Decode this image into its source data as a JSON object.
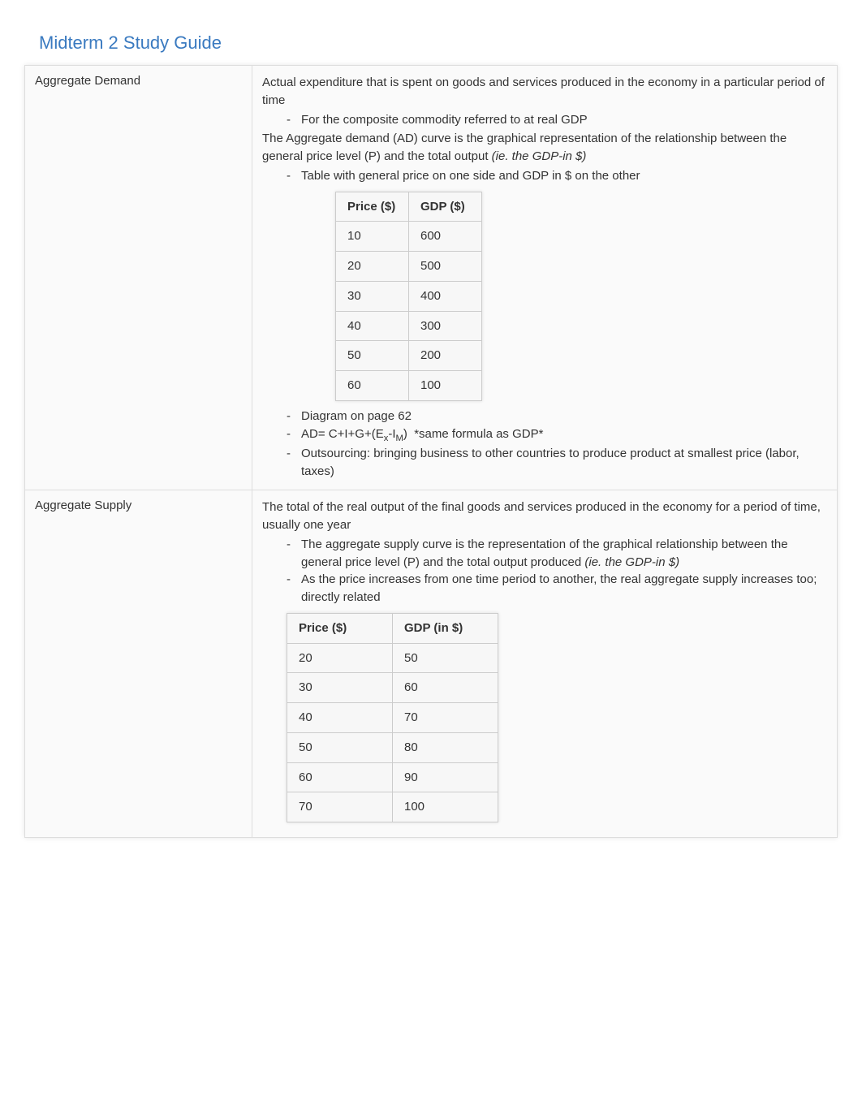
{
  "title": "Midterm 2 Study Guide",
  "rows": [
    {
      "term": "Aggregate Demand",
      "intro1": "Actual expenditure that is spent on goods and services produced in the economy in a particular period of time",
      "bullets1": [
        "For the composite commodity referred to at real GDP"
      ],
      "intro2a": "The Aggregate demand (AD) curve is the graphical representation of the relationship between the general price level (P) and the total output ",
      "intro2b": "(ie. the GDP-in $)",
      "bullets2": [
        "Table with general price on one side and GDP in $ on the other"
      ],
      "table": {
        "head": [
          "Price ($)",
          "GDP ($)"
        ],
        "body": [
          [
            "10",
            "600"
          ],
          [
            "20",
            "500"
          ],
          [
            "30",
            "400"
          ],
          [
            "40",
            "300"
          ],
          [
            "50",
            "200"
          ],
          [
            "60",
            "100"
          ]
        ]
      },
      "bullets3": [
        "Diagram on page 62",
        "AD= C+I+G+(Ex-IM)  *same formula as GDP*",
        "Outsourcing: bringing business to other countries to produce product at smallest price (labor, taxes)"
      ]
    },
    {
      "term": "Aggregate Supply",
      "intro1": "The total of the real output of the final goods and services produced in the economy for a period of time, usually one year",
      "bullets1a_pre": "The aggregate supply curve is the representation of the graphical relationship between the general price level (P) and the total output produced ",
      "bullets1a_italic": "(ie. the GDP-in $)",
      "bullets1b": "As the price increases from one time period to another, the real aggregate supply increases too; directly related",
      "table": {
        "head": [
          "Price ($)",
          "GDP (in $)"
        ],
        "body": [
          [
            "20",
            "50"
          ],
          [
            "30",
            "60"
          ],
          [
            "40",
            "70"
          ],
          [
            "50",
            "80"
          ],
          [
            "60",
            "90"
          ],
          [
            "70",
            "100"
          ]
        ]
      }
    }
  ]
}
